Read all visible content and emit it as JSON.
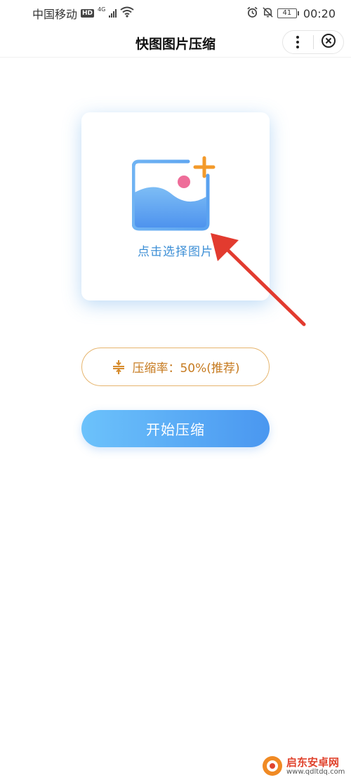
{
  "status_bar": {
    "carrier": "中国移动",
    "hd_badge": "HD",
    "network": "4G",
    "battery": "41",
    "time": "00:20"
  },
  "nav": {
    "title": "快图图片压缩"
  },
  "upload": {
    "label": "点击选择图片"
  },
  "ratio": {
    "label": "压缩率：50%(推荐)"
  },
  "start": {
    "label": "开始压缩"
  },
  "watermark": {
    "main": "启东安卓网",
    "url": "www.qdltdq.com"
  },
  "colors": {
    "accent_blue": "#4a97f0",
    "label_blue": "#3d8fd6",
    "ratio_orange": "#c67a1f",
    "ratio_border": "#e6b56e",
    "plus_orange": "#f39a2a",
    "dot_pink": "#ee6d99",
    "arrow_red": "#e23b2f"
  },
  "icons": [
    "alarm-icon",
    "mute-bell-icon",
    "wifi-icon",
    "more-icon",
    "close-icon",
    "image-add-icon",
    "compress-ratio-icon"
  ]
}
